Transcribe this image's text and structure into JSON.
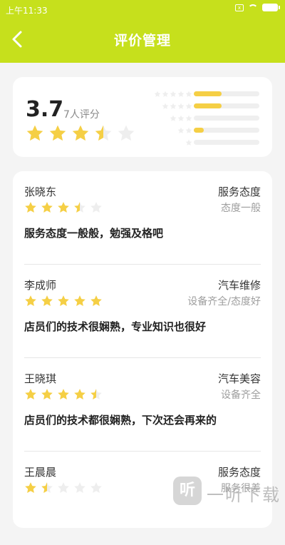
{
  "status_bar": {
    "time": "上午11:33",
    "sim_label": "x"
  },
  "header": {
    "title": "评价管理",
    "background": "#c6e01c"
  },
  "summary": {
    "score": "3.7",
    "rater_count": "7人评分",
    "rating": 3.5,
    "distribution": [
      {
        "stars": 5,
        "fraction": 0.42
      },
      {
        "stars": 4,
        "fraction": 0.42
      },
      {
        "stars": 3,
        "fraction": 0
      },
      {
        "stars": 2,
        "fraction": 0.15
      },
      {
        "stars": 1,
        "fraction": 0
      }
    ]
  },
  "reviews": [
    {
      "name": "张晓东",
      "rating": 3.5,
      "category": "服务态度",
      "tag": "态度一般",
      "comment": "服务态度一般般，勉强及格吧"
    },
    {
      "name": "李成师",
      "rating": 5,
      "category": "汽车维修",
      "tag": "设备齐全/态度好",
      "comment": "店员们的技术很娴熟，专业知识也很好"
    },
    {
      "name": "王晓琪",
      "rating": 4.5,
      "category": "汽车美容",
      "tag": "设备齐全",
      "comment": "店员们的技术都很娴熟，下次还会再来的"
    },
    {
      "name": "王晨晨",
      "rating": 1.5,
      "category": "服务态度",
      "tag": "服务很差",
      "comment": ""
    }
  ],
  "watermark": {
    "logo": "听",
    "text": "一听下载"
  },
  "colors": {
    "star_filled": "#f5cf45",
    "star_empty": "#eeeeee",
    "header": "#c6e01c"
  }
}
